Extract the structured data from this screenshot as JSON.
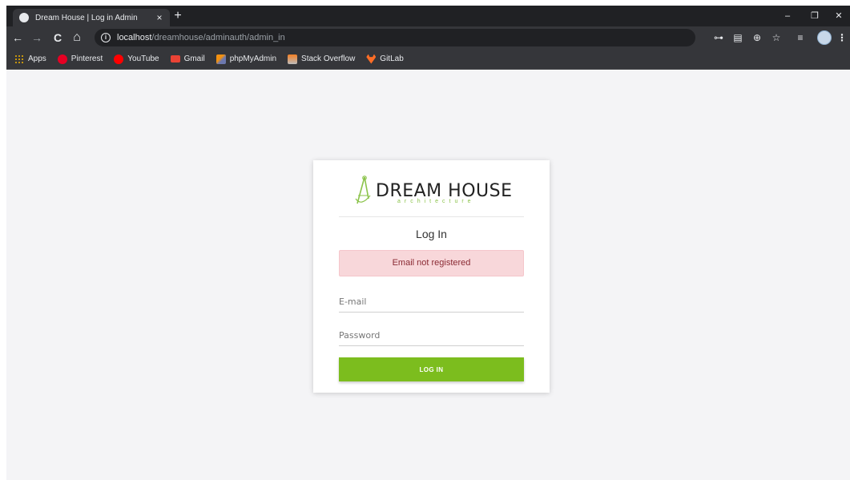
{
  "browser": {
    "tab_title": "Dream House | Log in Admin",
    "tab_close": "×",
    "new_tab": "+",
    "url_host": "localhost",
    "url_path": "/dreamhouse/adminauth/admin_in",
    "bookmarks": [
      "Apps",
      "Pinterest",
      "YouTube",
      "Gmail",
      "phpMyAdmin",
      "Stack Overflow",
      "GitLab"
    ],
    "icons": {
      "back": "←",
      "forward": "→",
      "reload": "C",
      "home": "⌂",
      "info": "i",
      "key": "⊶",
      "translate": "▤",
      "zoom": "⊕",
      "star": "☆",
      "media": "≡",
      "menu": "⋮",
      "minimize": "–",
      "restore": "❐",
      "close": "✕"
    }
  },
  "login": {
    "logo_text": "DREAM HOUSE",
    "logo_sub": "architecture",
    "title": "Log In",
    "alert": "Email not registered",
    "email_placeholder": "E-mail",
    "password_placeholder": "Password",
    "button_label": "LOG IN"
  },
  "colors": {
    "accent": "#7cbd1e",
    "alert_bg": "#f8d7da",
    "alert_text": "#8a2a33",
    "chrome_dark": "#202124",
    "chrome": "#35363a"
  }
}
